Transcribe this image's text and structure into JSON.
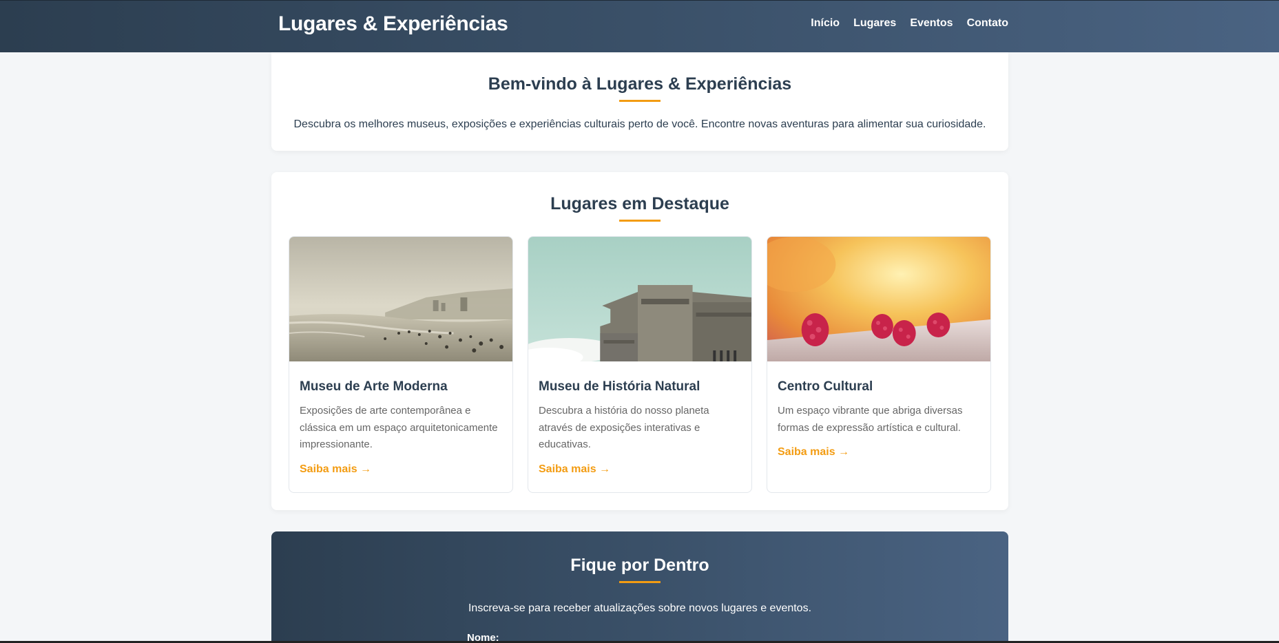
{
  "header": {
    "logo": "Lugares & Experiências",
    "nav": [
      "Início",
      "Lugares",
      "Eventos",
      "Contato"
    ]
  },
  "welcome": {
    "title": "Bem-vindo à Lugares & Experiências",
    "text": "Descubra os melhores museus, exposições e experiências culturais perto de você. Encontre novas aventuras para alimentar sua curiosidade."
  },
  "featured": {
    "title": "Lugares em Destaque",
    "cards": [
      {
        "title": "Museu de Arte Moderna",
        "desc": "Exposições de arte contemporânea e clássica em um espaço arquitetonicamente impressionante.",
        "link": "Saiba mais →",
        "image": "beach-photo"
      },
      {
        "title": "Museu de História Natural",
        "desc": "Descubra a história do nosso planeta através de exposições interativas e educativas.",
        "link": "Saiba mais →",
        "image": "concrete-building-photo"
      },
      {
        "title": "Centro Cultural",
        "desc": "Um espaço vibrante que abriga diversas formas de expressão artística e cultural.",
        "link": "Saiba mais →",
        "image": "raspberries-photo"
      }
    ]
  },
  "newsletter": {
    "title": "Fique por Dentro",
    "text": "Inscreva-se para receber atualizações sobre novos lugares e eventos.",
    "name_label": "Nome:"
  },
  "colors": {
    "primary": "#2c3e50",
    "accent": "#f39c12",
    "background": "#f4f6f8"
  }
}
